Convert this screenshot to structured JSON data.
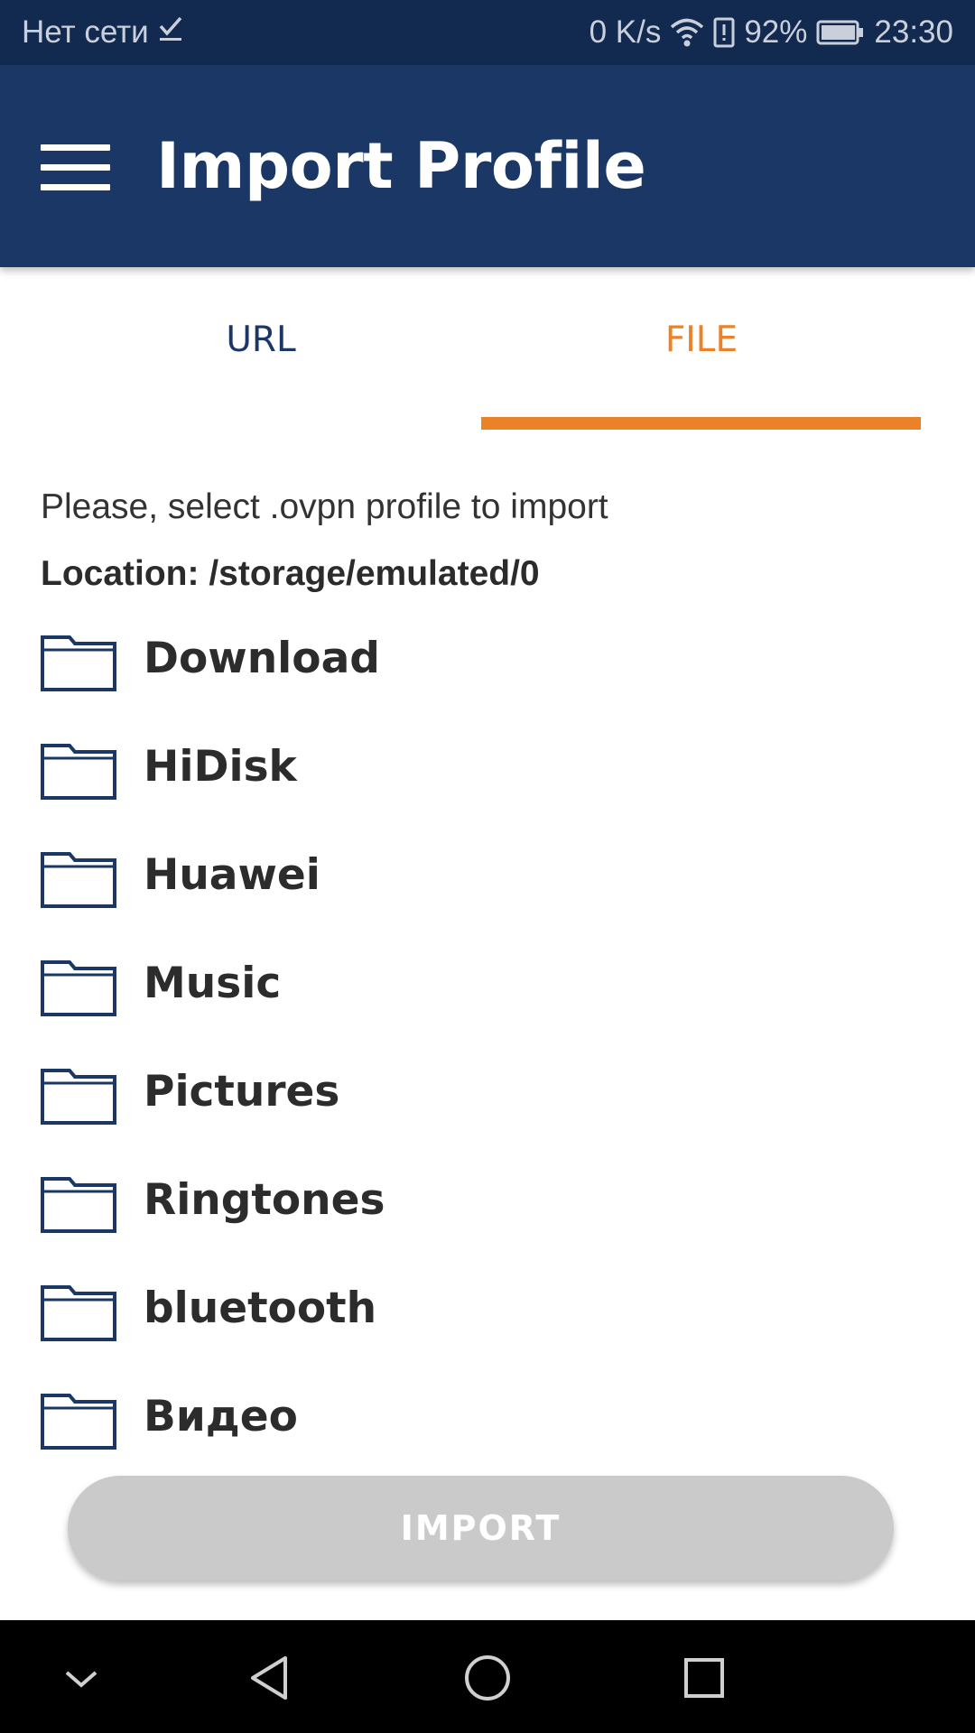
{
  "status_bar": {
    "network_text": "Нет сети",
    "speed": "0 K/s",
    "battery_percent": "92%",
    "time": "23:30",
    "icons": [
      "check-icon",
      "wifi-icon",
      "battery-alert-icon",
      "battery-icon"
    ]
  },
  "app_bar": {
    "title": "Import Profile",
    "menu_icon": "hamburger-menu-icon",
    "background": "#1b3766"
  },
  "tabs": [
    {
      "label": "URL",
      "selected": false
    },
    {
      "label": "FILE",
      "selected": true
    }
  ],
  "accent_color": "#ec8228",
  "content": {
    "hint": "Please, select .ovpn profile to import",
    "location": "Location: /storage/emulated/0",
    "folders": [
      {
        "name": "Download",
        "icon": "folder-icon"
      },
      {
        "name": "HiDisk",
        "icon": "folder-icon"
      },
      {
        "name": "Huawei",
        "icon": "folder-icon"
      },
      {
        "name": "Music",
        "icon": "folder-icon"
      },
      {
        "name": "Pictures",
        "icon": "folder-icon"
      },
      {
        "name": "Ringtones",
        "icon": "folder-icon"
      },
      {
        "name": "bluetooth",
        "icon": "folder-icon"
      },
      {
        "name": "Видео",
        "icon": "folder-icon"
      }
    ]
  },
  "import_button": {
    "label": "IMPORT",
    "enabled": false
  },
  "nav_bar": {
    "buttons": [
      "collapse-icon",
      "back-icon",
      "home-icon",
      "recents-icon"
    ]
  }
}
